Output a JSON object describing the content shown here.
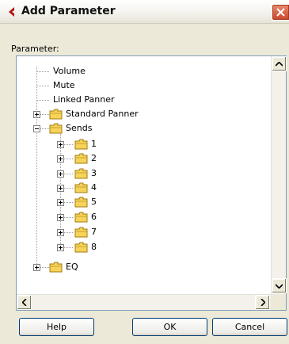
{
  "window": {
    "title": "Add Parameter"
  },
  "parameter_label": "Parameter:",
  "tree": {
    "items": [
      {
        "label": "Volume",
        "type": "leaf"
      },
      {
        "label": "Mute",
        "type": "leaf"
      },
      {
        "label": "Linked Panner",
        "type": "leaf"
      },
      {
        "label": "Standard Panner",
        "type": "folder",
        "expanded": false
      },
      {
        "label": "Sends",
        "type": "folder",
        "expanded": true,
        "children": [
          {
            "label": "1",
            "type": "folder",
            "expanded": false
          },
          {
            "label": "2",
            "type": "folder",
            "expanded": false
          },
          {
            "label": "3",
            "type": "folder",
            "expanded": false
          },
          {
            "label": "4",
            "type": "folder",
            "expanded": false
          },
          {
            "label": "5",
            "type": "folder",
            "expanded": false
          },
          {
            "label": "6",
            "type": "folder",
            "expanded": false
          },
          {
            "label": "7",
            "type": "folder",
            "expanded": false
          },
          {
            "label": "8",
            "type": "folder",
            "expanded": false
          }
        ]
      },
      {
        "label": "EQ",
        "type": "folder",
        "expanded": false
      }
    ]
  },
  "buttons": {
    "help": "Help",
    "ok": "OK",
    "cancel": "Cancel"
  },
  "colors": {
    "dialog_bg": "#ece9d8",
    "close_red": "#c9452a",
    "app_icon_red": "#b01010",
    "folder_yellow": "#f7d35a"
  },
  "icons": {
    "app": "cubase-arrow-icon",
    "close": "close-x-icon",
    "folder": "folder-icon",
    "scroll_up": "arrow-up-icon",
    "scroll_down": "arrow-down-icon",
    "scroll_left": "arrow-left-icon",
    "scroll_right": "arrow-right-icon"
  }
}
